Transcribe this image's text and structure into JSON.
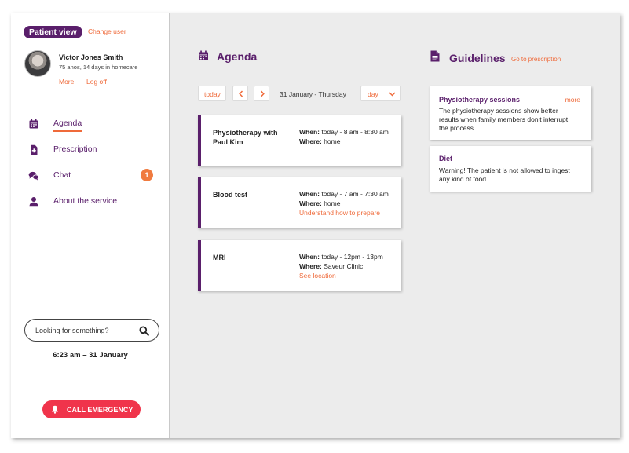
{
  "user": {
    "view_label": "Patient view",
    "change_user": "Change user",
    "name": "Victor Jones Smith",
    "details": "75 anos, 14 days in homecare",
    "more": "More",
    "logout": "Log off"
  },
  "nav": {
    "items": [
      {
        "label": "Agenda",
        "icon": "calendar-icon"
      },
      {
        "label": "Prescription",
        "icon": "document-plus-icon"
      },
      {
        "label": "Chat",
        "icon": "chat-bubbles-icon",
        "badge": "1"
      },
      {
        "label": "About the service",
        "icon": "person-icon"
      }
    ]
  },
  "search": {
    "placeholder": "Looking for something?"
  },
  "clock": "6:23 am – 31 January",
  "emergency": {
    "label": "CALL EMERGENCY"
  },
  "agenda": {
    "title": "Agenda",
    "today": "today",
    "date": "31 January - Thursday",
    "view": "day",
    "appointments": [
      {
        "title": "Physiotherapy with Paul Kim",
        "when_label": "When:",
        "when": "today - 8 am - 8:30 am",
        "where_label": "Where:",
        "where": "home",
        "link": ""
      },
      {
        "title": "Blood test",
        "when_label": "When:",
        "when": "today - 7 am - 7:30 am",
        "where_label": "Where:",
        "where": "home",
        "link": "Understand how to prepare"
      },
      {
        "title": "MRI",
        "when_label": "When:",
        "when": "today - 12pm - 13pm",
        "where_label": "Where:",
        "where": "Saveur Clinic",
        "link": "See location"
      }
    ]
  },
  "guidelines": {
    "title": "Guidelines",
    "link": "Go to prescription",
    "items": [
      {
        "title": "Physiotherapy sessions",
        "more": "more",
        "text": "The physiotherapy sessions show better results when family members don't interrupt the process."
      },
      {
        "title": "Diet",
        "more": "",
        "text": "Warning! The patient is not allowed to ingest any kind of food."
      }
    ]
  },
  "colors": {
    "brand": "#5a1f6b",
    "accent": "#ef6a3a",
    "emergency": "#f0344b",
    "badge": "#f07b3f"
  }
}
